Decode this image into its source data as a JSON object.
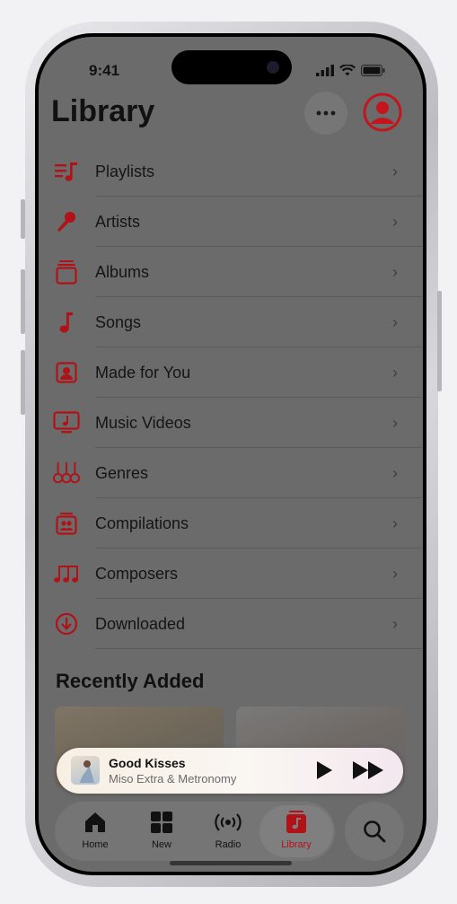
{
  "status": {
    "time": "9:41"
  },
  "header": {
    "title": "Library",
    "more_icon": "ellipsis-icon",
    "account_icon": "person-circle-icon"
  },
  "menu": [
    {
      "label": "Playlists",
      "icon": "playlist-icon"
    },
    {
      "label": "Artists",
      "icon": "microphone-icon"
    },
    {
      "label": "Albums",
      "icon": "album-stack-icon"
    },
    {
      "label": "Songs",
      "icon": "music-note-icon"
    },
    {
      "label": "Made for You",
      "icon": "person-square-icon"
    },
    {
      "label": "Music Videos",
      "icon": "tv-music-icon"
    },
    {
      "label": "Genres",
      "icon": "guitars-icon"
    },
    {
      "label": "Compilations",
      "icon": "compilation-icon"
    },
    {
      "label": "Composers",
      "icon": "music-notes-icon"
    },
    {
      "label": "Downloaded",
      "icon": "download-circle-icon"
    }
  ],
  "recently_added": {
    "title": "Recently Added"
  },
  "miniplayer": {
    "title": "Good Kisses",
    "subtitle": "Miso Extra & Metronomy"
  },
  "tabs": [
    {
      "label": "Home",
      "icon": "house-icon",
      "selected": false
    },
    {
      "label": "New",
      "icon": "grid-icon",
      "selected": false
    },
    {
      "label": "Radio",
      "icon": "radio-waves-icon",
      "selected": false
    },
    {
      "label": "Library",
      "icon": "library-note-icon",
      "selected": true
    }
  ],
  "colors": {
    "accent": "#c4151c",
    "dim_overlay": "#6b6b6b"
  }
}
